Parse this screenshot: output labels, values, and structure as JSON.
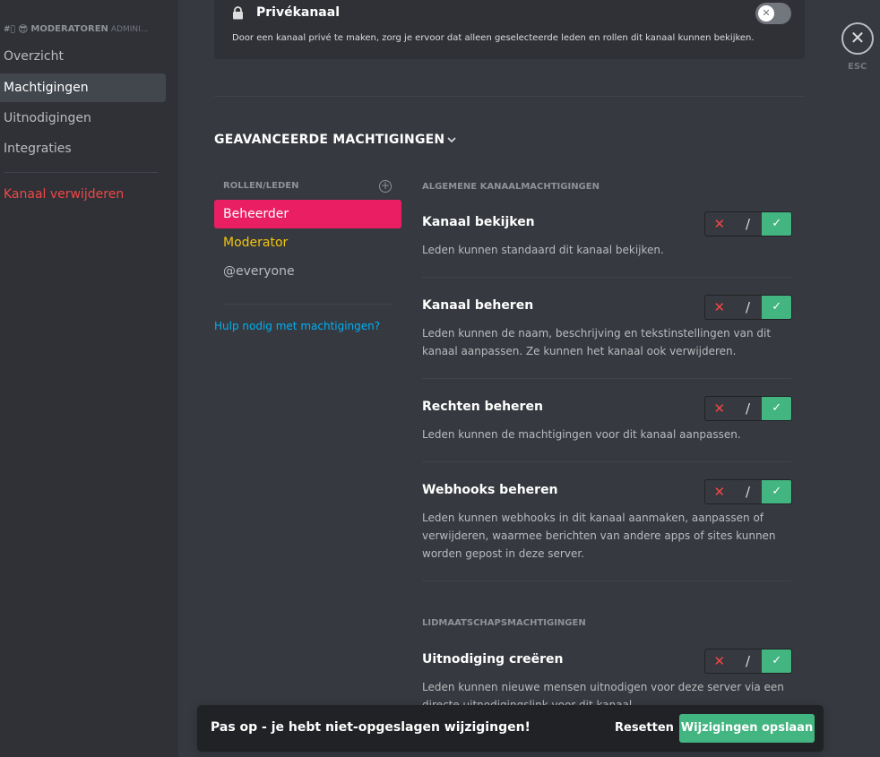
{
  "sidebar": {
    "header_icon": "#⃣",
    "header_emoji": "😎",
    "header_title": "MODERATOREN",
    "header_sub": "ADMINI...",
    "items": [
      {
        "label": "Overzicht"
      },
      {
        "label": "Machtigingen"
      },
      {
        "label": "Uitnodigingen"
      },
      {
        "label": "Integraties"
      }
    ],
    "delete_label": "Kanaal verwijderen"
  },
  "private": {
    "title": "Privékanaal",
    "description": "Door een kanaal privé te maken, zorg je ervoor dat alleen geselecteerde leden en rollen dit kanaal kunnen bekijken.",
    "toggle_icon": "✕"
  },
  "close": {
    "icon": "✕",
    "label": "ESC"
  },
  "advanced": {
    "title": "GEAVANCEERDE MACHTIGINGEN",
    "chevron": "⌄"
  },
  "roles": {
    "header": "ROLLEN/LEDEN",
    "add_icon": "+",
    "items": [
      {
        "label": "Beheerder"
      },
      {
        "label": "Moderator"
      },
      {
        "label": "@everyone"
      }
    ],
    "help_link": "Hulp nodig met machtigingen?"
  },
  "permissions": {
    "section_general": "ALGEMENE KANAALMACHTIGINGEN",
    "section_membership": "LIDMAATSCHAPSMACHTIGINGEN",
    "items": [
      {
        "title": "Kanaal bekijken",
        "desc": "Leden kunnen standaard dit kanaal bekijken."
      },
      {
        "title": "Kanaal beheren",
        "desc": "Leden kunnen de naam, beschrijving en tekstinstellingen van dit kanaal aanpassen. Ze kunnen het kanaal ook verwijderen."
      },
      {
        "title": "Rechten beheren",
        "desc": "Leden kunnen de machtigingen voor dit kanaal aanpassen."
      },
      {
        "title": "Webhooks beheren",
        "desc": "Leden kunnen webhooks in dit kanaal aanmaken, aanpassen of verwijderen, waarmee berichten van andere apps of sites kunnen worden gepost in deze server."
      },
      {
        "title": "Uitnodiging creëren",
        "desc": "Leden kunnen nieuwe mensen uitnodigen voor deze server via een directe uitnodigingslink voor dit kanaal."
      }
    ],
    "deny": "✕",
    "neutral": "/",
    "allow": "✓"
  },
  "notice": {
    "text": "Pas op - je hebt niet-opgeslagen wijzigingen!",
    "reset": "Resetten",
    "save": "Wijzigingen opslaan"
  },
  "colors": {
    "accent_role": "#e91e63",
    "moderator": "#f1c40f",
    "allow_green": "#43b581",
    "deny_red": "#f04747",
    "link": "#00b0f4"
  }
}
